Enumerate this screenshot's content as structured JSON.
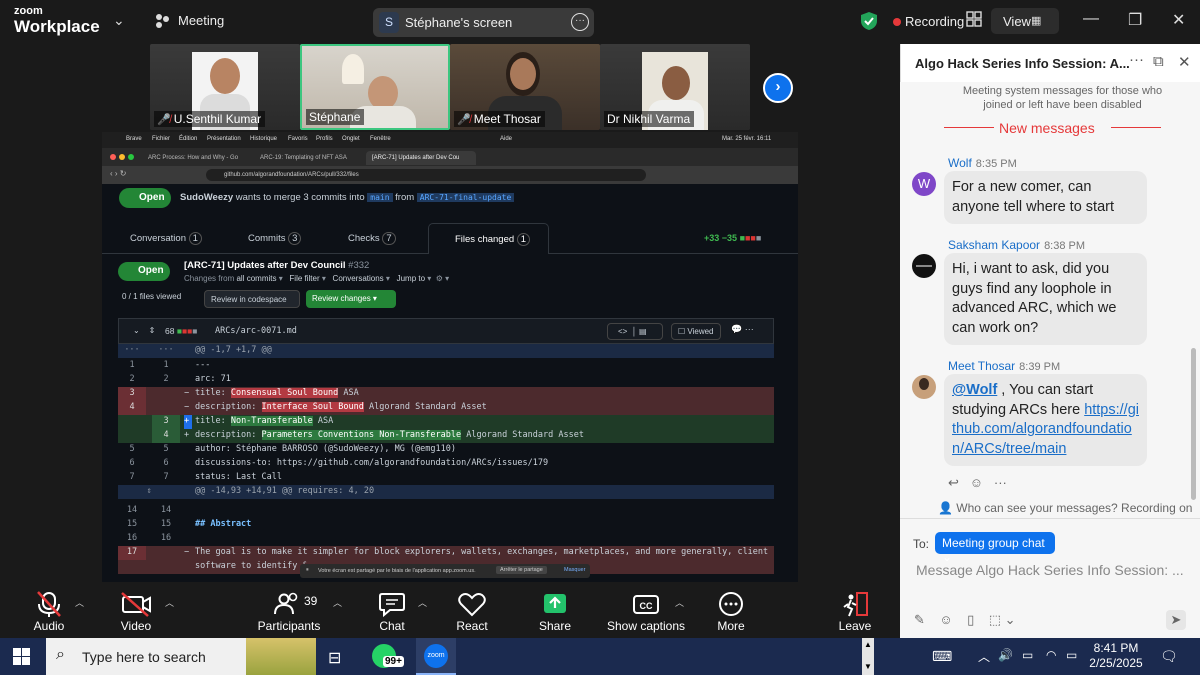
{
  "topbar": {
    "brand_line1": "zoom",
    "brand_line2": "Workplace",
    "meeting_label": "Meeting",
    "screen_badge": "S",
    "screen_label": "Stéphane's screen",
    "recording_label": "Recording",
    "view_label": "View"
  },
  "participants": [
    {
      "name": "U.Senthil Kumar",
      "muted": true
    },
    {
      "name": "Stéphane",
      "muted": false,
      "active": true
    },
    {
      "name": "Meet Thosar",
      "muted": true
    },
    {
      "name": "Dr Nikhil Varma",
      "muted": false
    }
  ],
  "shared": {
    "mac_menu": [
      "Brave",
      "Fichier",
      "Édition",
      "Présentation",
      "Historique",
      "Favoris",
      "Profils",
      "Onglet",
      "Fenêtre",
      "Aide"
    ],
    "mac_clock": "Mar. 25 févr. 16:11",
    "tabs": [
      "ARC Process: How and Why - Go",
      "ARC-19: Templating of NFT ASA",
      "[ARC-71] Updates after Dev Cou"
    ],
    "url": "github.com/algorandfoundation/ARCs/pull/332/files",
    "pr_open": "Open",
    "pr_summary_user": "SudoWeezy",
    "pr_summary_mid": " wants to merge 3 commits into ",
    "pr_summary_base": "main",
    "pr_summary_from": " from ",
    "pr_summary_head": "ARC-71-final-update",
    "pr_tabs": [
      {
        "label": "Conversation",
        "count": "1"
      },
      {
        "label": "Commits",
        "count": "3"
      },
      {
        "label": "Checks",
        "count": "7"
      },
      {
        "label": "Files changed",
        "count": "1"
      }
    ],
    "diffstat": "+33 −35",
    "pr_title": "[ARC-71] Updates after Dev Council",
    "pr_number": "#332",
    "changes_from": "Changes from",
    "all_commits": "all commits",
    "file_filter": "File filter",
    "conversations": "Conversations",
    "jump_to": "Jump to",
    "files_viewed": "0 / 1 files viewed",
    "review_codespace": "Review in codespace",
    "review_changes": "Review changes",
    "file_changes": "68",
    "file_path": "ARCs/arc-0071.md",
    "viewed_label": "Viewed",
    "hunk1": "@@ -1,7 +1,7 @@",
    "hunk2": "@@ -14,93 +14,91 @@ requires: 4, 20",
    "banner_text": "Votre écran est partagé par le biais de l'application app.zoom.us.",
    "banner_stop": "Arrêter le partage",
    "banner_hide": "Masquer"
  },
  "toolbar": {
    "audio": "Audio",
    "video": "Video",
    "participants": "Participants",
    "participants_count": "39",
    "chat": "Chat",
    "react": "React",
    "share": "Share",
    "captions": "Show captions",
    "more": "More",
    "leave": "Leave"
  },
  "chat": {
    "title": "Algo Hack Series Info Session: A...",
    "system_msg": "Meeting system messages for those who joined or left have been disabled",
    "new_messages": "New messages",
    "messages": [
      {
        "sender": "Wolf",
        "time": "8:35 PM",
        "avatar": "W",
        "text": "For a new comer, can anyone tell where to start"
      },
      {
        "sender": "Saksham Kapoor",
        "time": "8:38 PM",
        "text": "Hi, i want to ask, did you guys find any loophole in advanced ARC, which we can work on?"
      },
      {
        "sender": "Meet Thosar",
        "time": "8:39 PM",
        "mention": "@Wolf",
        "text": " , You can start studying ARCs here ",
        "link": "https://github.com/algorandfoundation/ARCs/tree/main"
      }
    ],
    "who_can_see": "Who can see your messages? Recording on",
    "to_label": "To:",
    "to_target": "Meeting group chat",
    "input_placeholder": "Message Algo Hack Series Info Session: ..."
  },
  "taskbar": {
    "search_placeholder": "Type here to search",
    "whatsapp_badge": "99+",
    "time": "8:41 PM",
    "date": "2/25/2025"
  }
}
